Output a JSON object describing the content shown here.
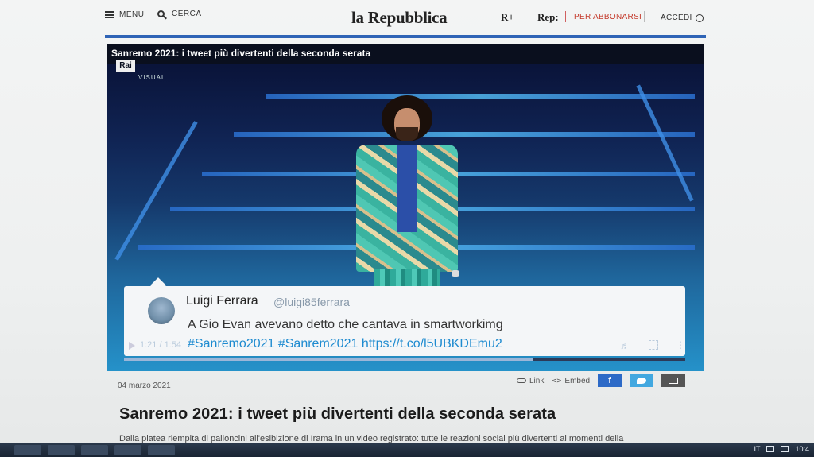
{
  "header": {
    "menu_label": "MENU",
    "search_label": "CERCA",
    "logo": "la Repubblica",
    "rplus": "R+",
    "rep": "Rep:",
    "subscribe_label": "PER ABBONARSI",
    "login_label": "ACCEDI"
  },
  "video": {
    "title": "Sanremo 2021: i tweet più divertenti della seconda serata",
    "channel_logo": "Rai",
    "channel_sub": "VISUAL",
    "time_display": "1:21 / 1:54",
    "progress_fraction": 0.73
  },
  "tweet": {
    "name": "Luigi Ferrara",
    "handle": "@luigi85ferrara",
    "text": "A Gio Evan avevano detto che cantava in smartworkimg",
    "link_text": "#Sanremo2021 #Sanrem2021 https://t.co/l5UBKDEmu2"
  },
  "article": {
    "date": "04 marzo 2021",
    "share_link_label": "Link",
    "share_embed_label": "Embed",
    "headline": "Sanremo 2021: i tweet più divertenti della seconda serata",
    "summary": "Dalla platea riempita di palloncini all'esibizione di Irama in un video registrato: tutte le reazioni social più divertenti ai momenti della"
  },
  "taskbar": {
    "language": "IT",
    "clock": "10:4"
  },
  "colors": {
    "accent_blue": "#2f64b6",
    "subscribe_red": "#c43a2b",
    "facebook": "#2d6ac7",
    "twitter": "#42a8e0"
  },
  "icons": [
    "hamburger-icon",
    "search-icon",
    "user-icon",
    "play-icon",
    "volume-icon",
    "fullscreen-icon",
    "link-icon",
    "embed-icon",
    "facebook-icon",
    "twitter-icon",
    "mail-icon"
  ]
}
